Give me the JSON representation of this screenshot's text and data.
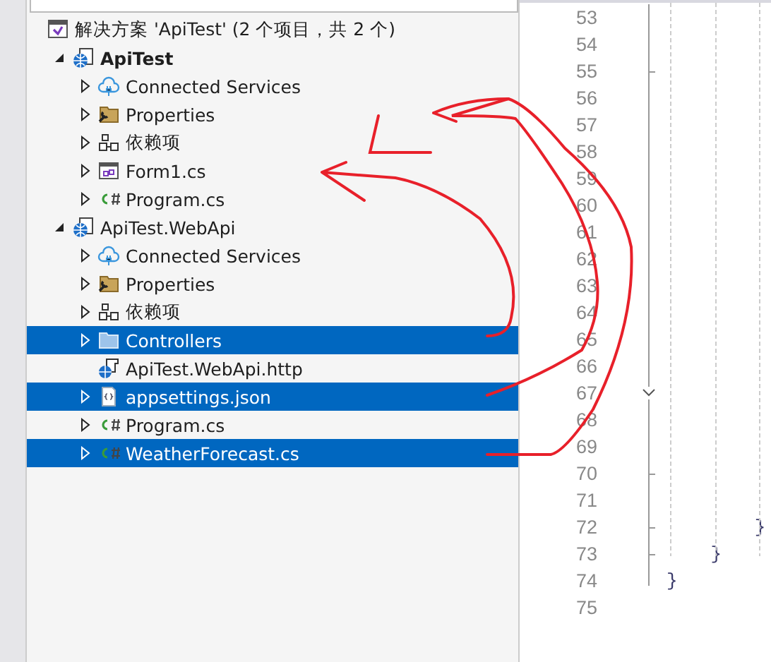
{
  "solution_explorer": {
    "search": {
      "kind": "field"
    },
    "solution": {
      "label": "解决方案 'ApiTest' (2 个项目，共 2 个)",
      "children": [
        {
          "label": "ApiTest",
          "kind": "project",
          "bold": true,
          "has_children": true,
          "expanded": true,
          "selected": false,
          "children": [
            {
              "label": "Connected Services",
              "kind": "services",
              "has_children": true,
              "expanded": false,
              "selected": false
            },
            {
              "label": "Properties",
              "kind": "properties",
              "has_children": true,
              "expanded": false,
              "selected": false
            },
            {
              "label": "依赖项",
              "kind": "dependencies",
              "has_children": true,
              "expanded": false,
              "selected": false
            },
            {
              "label": "Form1.cs",
              "kind": "form",
              "has_children": true,
              "expanded": false,
              "selected": false
            },
            {
              "label": "Program.cs",
              "kind": "csharp",
              "has_children": true,
              "expanded": false,
              "selected": false
            }
          ]
        },
        {
          "label": "ApiTest.WebApi",
          "kind": "project",
          "bold": false,
          "has_children": true,
          "expanded": true,
          "selected": false,
          "children": [
            {
              "label": "Connected Services",
              "kind": "services",
              "has_children": true,
              "expanded": false,
              "selected": false
            },
            {
              "label": "Properties",
              "kind": "properties",
              "has_children": true,
              "expanded": false,
              "selected": false
            },
            {
              "label": "依赖项",
              "kind": "dependencies",
              "has_children": true,
              "expanded": false,
              "selected": false
            },
            {
              "label": "Controllers",
              "kind": "folder",
              "has_children": true,
              "expanded": false,
              "selected": true
            },
            {
              "label": "ApiTest.WebApi.http",
              "kind": "http",
              "has_children": false,
              "selected": false
            },
            {
              "label": "appsettings.json",
              "kind": "json",
              "has_children": true,
              "expanded": false,
              "selected": true
            },
            {
              "label": "Program.cs",
              "kind": "csharp",
              "has_children": true,
              "expanded": false,
              "selected": false
            },
            {
              "label": "WeatherForecast.cs",
              "kind": "csharp",
              "has_children": true,
              "expanded": false,
              "selected": true
            }
          ]
        }
      ]
    }
  },
  "editor": {
    "lines": [
      {
        "number": "53"
      },
      {
        "number": "54"
      },
      {
        "number": "55"
      },
      {
        "number": "56"
      },
      {
        "number": "57"
      },
      {
        "number": "58"
      },
      {
        "number": "59"
      },
      {
        "number": "60"
      },
      {
        "number": "61"
      },
      {
        "number": "62"
      },
      {
        "number": "63"
      },
      {
        "number": "64"
      },
      {
        "number": "65"
      },
      {
        "number": "66"
      },
      {
        "number": "67"
      },
      {
        "number": "68"
      },
      {
        "number": "69"
      },
      {
        "number": "70"
      },
      {
        "number": "71"
      },
      {
        "number": "72",
        "code": "        }"
      },
      {
        "number": "73",
        "code": "    }"
      },
      {
        "number": "74",
        "code": "}"
      },
      {
        "number": "75"
      }
    ]
  }
}
